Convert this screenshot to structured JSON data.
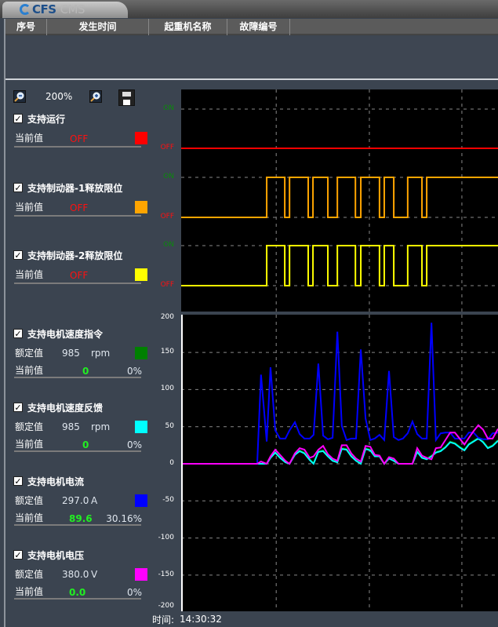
{
  "app": {
    "logo_text": "CFS",
    "logo_sub": "CMS"
  },
  "table": {
    "columns": [
      "序号",
      "发生时间",
      "起重机名称",
      "故障编号"
    ]
  },
  "toolbar": {
    "zoom_level": "200%",
    "zoom_out": "zoom-out",
    "zoom_in": "zoom-in",
    "save": "save"
  },
  "labels": {
    "current": "当前值",
    "rated": "额定值",
    "time_label": "时间:",
    "time_value": "14:30:32"
  },
  "digital_signals": [
    {
      "name": "支持运行",
      "checked": true,
      "value": "OFF",
      "color": "#ff0000"
    },
    {
      "name": "支持制动器-1释放限位",
      "checked": true,
      "value": "OFF",
      "color": "#ffa500"
    },
    {
      "name": "支持制动器-2释放限位",
      "checked": true,
      "value": "OFF",
      "color": "#ffff00"
    }
  ],
  "analog_signals": [
    {
      "name": "支持电机速度指令",
      "checked": true,
      "rated": "985",
      "unit": "rpm",
      "current": "0",
      "percent": "0%",
      "color": "#008000"
    },
    {
      "name": "支持电机速度反馈",
      "checked": true,
      "rated": "985",
      "unit": "rpm",
      "current": "0",
      "percent": "0%",
      "color": "#00ffff"
    },
    {
      "name": "支持电机电流",
      "checked": true,
      "rated": "297.0",
      "unit": "A",
      "current": "89.6",
      "percent": "30.16%",
      "color": "#0000ff"
    },
    {
      "name": "支持电机电压",
      "checked": true,
      "rated": "380.0",
      "unit": "V",
      "current": "0.0",
      "percent": "0%",
      "color": "#ff00ff"
    }
  ],
  "chart_data": [
    {
      "type": "line",
      "title": "digital",
      "state_labels": {
        "on": "ON",
        "off": "OFF"
      },
      "x_range": [
        0,
        100
      ],
      "series": [
        {
          "name": "支持运行",
          "color": "#ff0000",
          "initial": 0,
          "edges": []
        },
        {
          "name": "支持制动器-1释放限位",
          "color": "#ffa500",
          "initial": 0,
          "edges": [
            27,
            32.7,
            34.2,
            40.1,
            41.6,
            46.3,
            49.3,
            55,
            56.7,
            62.6,
            64.1,
            67.1,
            71.5,
            76,
            77.5
          ]
        },
        {
          "name": "支持制动器-2释放限位",
          "color": "#ffff00",
          "initial": 0,
          "edges": [
            27,
            32.7,
            34.2,
            40.1,
            41.6,
            46.3,
            49.3,
            55,
            56.7,
            62.6,
            64.1,
            67.1,
            71.5,
            76,
            77.5
          ]
        }
      ],
      "x_gridlines": [
        30,
        59.4,
        88.6
      ]
    },
    {
      "type": "line",
      "title": "analog",
      "ylim": [
        -200,
        200
      ],
      "yticks": [
        "200",
        "150",
        "100",
        "50",
        "0",
        "-50",
        "-100",
        "-150",
        "-200"
      ],
      "x_range": [
        0,
        100
      ],
      "x_gridlines": [
        30,
        59.4,
        88.6
      ],
      "x": [
        0,
        24,
        25.2,
        27,
        28.2,
        29.7,
        31.2,
        32.9,
        34.2,
        35.9,
        37.4,
        38.9,
        40.6,
        41.8,
        43.3,
        44.8,
        46.3,
        47.8,
        49.3,
        50.7,
        52.2,
        53.7,
        55.2,
        56.7,
        58.2,
        59.7,
        61.1,
        62.6,
        64.1,
        65.6,
        67.1,
        68.6,
        70,
        71.5,
        73,
        74.5,
        76,
        77.5,
        79,
        80.4,
        81.9,
        83.4,
        84.9,
        86.4,
        87.9,
        89.4,
        90.8,
        92.3,
        93.8,
        95.3,
        96.8,
        98.3,
        100
      ],
      "series": [
        {
          "name": "支持电机速度指令",
          "color": "#008000",
          "values": [
            0,
            0,
            0,
            0,
            8,
            16,
            9,
            3,
            0,
            13,
            18,
            15,
            6,
            1,
            17,
            18,
            11,
            5,
            3,
            21,
            20,
            11,
            5,
            1,
            21,
            19,
            11,
            10,
            0,
            8,
            5,
            0,
            0,
            0,
            0,
            17,
            9,
            7,
            11,
            16,
            18,
            23,
            30,
            28,
            23,
            19,
            27,
            31,
            35,
            30,
            22,
            25,
            32
          ]
        },
        {
          "name": "支持电机速度反馈",
          "color": "#00ffff",
          "values": [
            0,
            0,
            0,
            0,
            8,
            15,
            8,
            2,
            0,
            12,
            17,
            14,
            5,
            0,
            16,
            17,
            10,
            4,
            2,
            20,
            19,
            10,
            4,
            0,
            20,
            18,
            10,
            10,
            0,
            7,
            4,
            0,
            0,
            0,
            0,
            16,
            8,
            6,
            10,
            15,
            17,
            22,
            29,
            27,
            22,
            18,
            26,
            30,
            34,
            29,
            21,
            24,
            31
          ]
        },
        {
          "name": "支持电机电流",
          "color": "#0000ff",
          "values": [
            0,
            0,
            120,
            30,
            130,
            45,
            34,
            34,
            45,
            56,
            40,
            34,
            34,
            39,
            135,
            38,
            33,
            35,
            178,
            51,
            32,
            34,
            34,
            154,
            61,
            32,
            34,
            39,
            32,
            125,
            36,
            32,
            34,
            41,
            57,
            40,
            34,
            34,
            190,
            32,
            41,
            42,
            42,
            34,
            34,
            34,
            42,
            42,
            35,
            33,
            33,
            41,
            42
          ]
        },
        {
          "name": "支持电机电压",
          "color": "#ff00ff",
          "values": [
            0,
            0,
            3,
            0,
            10,
            19,
            12,
            4,
            0,
            14,
            21,
            19,
            8,
            10,
            19,
            24,
            13,
            7,
            4,
            25,
            25,
            14,
            7,
            3,
            24,
            23,
            12,
            11,
            0,
            9,
            7,
            0,
            0,
            0,
            0,
            21,
            11,
            8,
            6,
            21,
            22,
            32,
            42,
            42,
            34,
            26,
            35,
            44,
            52,
            46,
            34,
            34,
            47
          ]
        }
      ]
    }
  ]
}
